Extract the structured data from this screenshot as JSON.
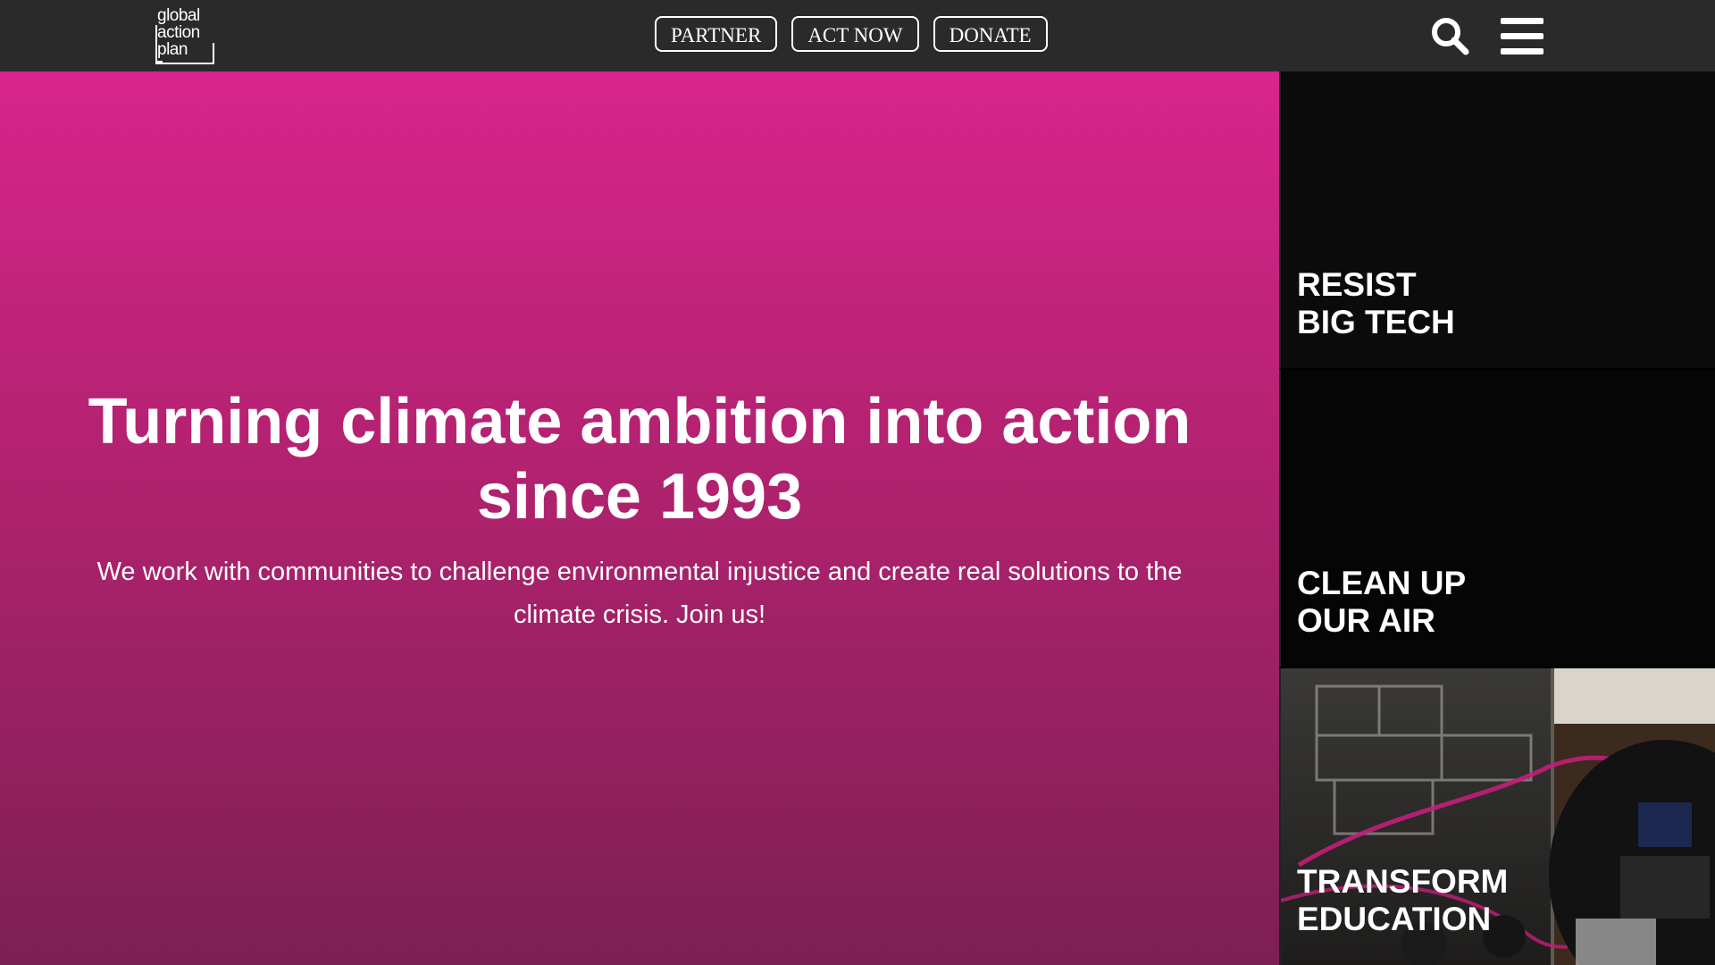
{
  "header": {
    "logo": {
      "lines": [
        "global",
        "action",
        "plan"
      ]
    },
    "nav_buttons": [
      {
        "label": "PARTNER"
      },
      {
        "label": "ACT NOW"
      },
      {
        "label": "DONATE"
      }
    ],
    "icons": [
      "search-icon",
      "menu-icon"
    ]
  },
  "hero": {
    "title": "Turning climate ambition into action since 1993",
    "subtitle": "We work with communities to challenge environmental injustice and create real solutions to the climate crisis. Join us!",
    "gradient_colors": [
      "#d8258b",
      "#7c1f54"
    ]
  },
  "side_tiles": [
    {
      "title": "RESIST\nBIG TECH"
    },
    {
      "title": "CLEAN UP\nOUR AIR"
    },
    {
      "title": "TRANSFORM\nEDUCATION"
    }
  ],
  "colors": {
    "header_bg": "#2a2a2a",
    "accent_pink": "#d8258b"
  }
}
